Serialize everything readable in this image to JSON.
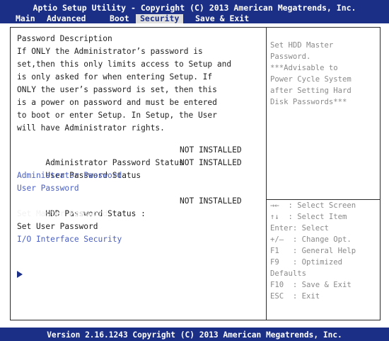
{
  "title": "Aptio Setup Utility - Copyright (C) 2013 American Megatrends, Inc.",
  "menu": {
    "main": "Main",
    "advanced": "Advanced",
    "boot": "Boot",
    "security": "Security",
    "save_exit": "Save & Exit",
    "selected": "Security"
  },
  "description": {
    "heading": "Password Description",
    "lines": [
      "If ONLY the Administrator’s password is",
      "set,then this only limits access to Setup and",
      "is only asked for when entering Setup. If",
      "ONLY the user’s password is set, then this",
      "is a power on password and must be entered",
      "to boot or enter Setup. In Setup, the User",
      "will have Administrator rights."
    ]
  },
  "items": {
    "admin_status_label": "Administrator Password Status",
    "admin_status_value": "NOT INSTALLED",
    "user_status_label": "User Password Status",
    "user_status_value": "NOT INSTALLED",
    "admin_password": "Administrator Password",
    "user_password": "User Password",
    "hdd_status_label": "HDD Password Status :",
    "hdd_status_value": "NOT INSTALLED",
    "set_master_password": "Set Master Password",
    "set_user_password": "Set User Password",
    "io_interface_security": "I/O Interface Security"
  },
  "help": [
    "Set HDD Master",
    "Password.",
    "***Advisable to",
    "Power Cycle System",
    "after Setting Hard",
    "Disk Passwords***"
  ],
  "keys": [
    "→←  : Select Screen",
    "↑↓  : Select Item",
    "Enter: Select",
    "+/—  : Change Opt.",
    "F1   : General Help",
    "F9   : Optimized",
    "Defaults",
    "F10  : Save & Exit",
    "ESC  : Exit"
  ],
  "footer": "Version 2.16.1243 Copyright (C) 2013 American Megatrends, Inc.",
  "colors": {
    "bar_blue": "#1b2f86",
    "link_blue": "#4a5fc1",
    "help_gray": "#8a8a8a",
    "tab_highlight": "#dcdcdc"
  }
}
